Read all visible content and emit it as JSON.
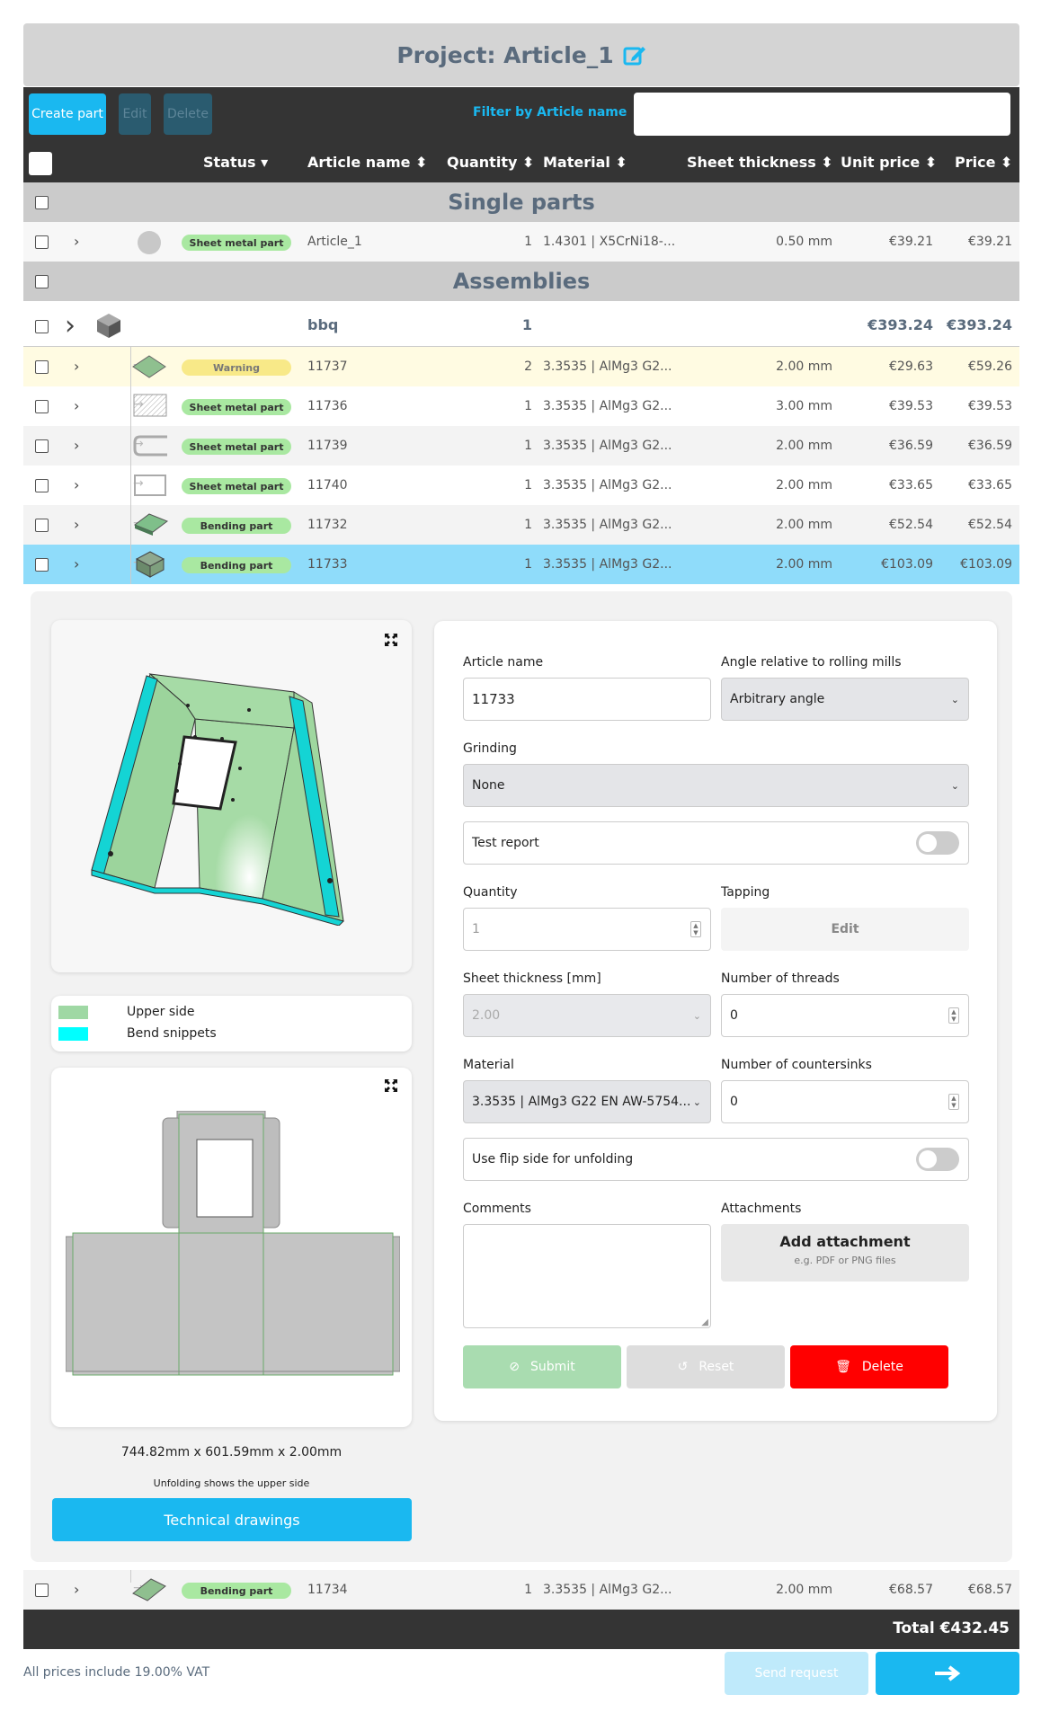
{
  "project": {
    "title": "Project: Article_1"
  },
  "toolbar": {
    "create_label": "Create part",
    "edit_label": "Edit",
    "delete_label": "Delete",
    "filter_label": "Filter by Article name",
    "filter_value": ""
  },
  "columns": {
    "status": "Status",
    "article": "Article name",
    "quantity": "Quantity",
    "material": "Material",
    "thickness": "Sheet thickness",
    "unit_price": "Unit price",
    "price": "Price"
  },
  "sections": {
    "single": "Single parts",
    "assemblies": "Assemblies"
  },
  "single_parts": [
    {
      "status": "Sheet metal part",
      "name": "Article_1",
      "qty": "1",
      "material": "1.4301 | X5CrNi18-...",
      "thickness": "0.50 mm",
      "unit": "€39.21",
      "price": "€39.21"
    }
  ],
  "assembly": {
    "name": "bbq",
    "qty": "1",
    "unit": "€393.24",
    "price": "€393.24"
  },
  "assembly_parts": [
    {
      "status": "Warning",
      "name": "11737",
      "qty": "2",
      "material": "3.3535 | AlMg3 G2...",
      "thickness": "2.00 mm",
      "unit": "€29.63",
      "price": "€59.26"
    },
    {
      "status": "Sheet metal part",
      "name": "11736",
      "qty": "1",
      "material": "3.3535 | AlMg3 G2...",
      "thickness": "3.00 mm",
      "unit": "€39.53",
      "price": "€39.53"
    },
    {
      "status": "Sheet metal part",
      "name": "11739",
      "qty": "1",
      "material": "3.3535 | AlMg3 G2...",
      "thickness": "2.00 mm",
      "unit": "€36.59",
      "price": "€36.59"
    },
    {
      "status": "Sheet metal part",
      "name": "11740",
      "qty": "1",
      "material": "3.3535 | AlMg3 G2...",
      "thickness": "2.00 mm",
      "unit": "€33.65",
      "price": "€33.65"
    },
    {
      "status": "Bending part",
      "name": "11732",
      "qty": "1",
      "material": "3.3535 | AlMg3 G2...",
      "thickness": "2.00 mm",
      "unit": "€52.54",
      "price": "€52.54"
    },
    {
      "status": "Bending part",
      "name": "11733",
      "qty": "1",
      "material": "3.3535 | AlMg3 G2...",
      "thickness": "2.00 mm",
      "unit": "€103.09",
      "price": "€103.09"
    }
  ],
  "last_part": {
    "status": "Bending part",
    "name": "11734",
    "qty": "1",
    "material": "3.3535 | AlMg3 G2...",
    "thickness": "2.00 mm",
    "unit": "€68.57",
    "price": "€68.57"
  },
  "legend": {
    "upper": "Upper side",
    "bend": "Bend snippets",
    "upper_color": "#9fd8a4",
    "bend_color": "#00ffff"
  },
  "viewer": {
    "dimensions": "744.82mm x 601.59mm x 2.00mm",
    "unfold_note": "Unfolding shows the upper side",
    "tech_label": "Technical drawings"
  },
  "form": {
    "article_label": "Article name",
    "article_value": "11733",
    "angle_label": "Angle relative to rolling mills",
    "angle_value": "Arbitrary angle",
    "grinding_label": "Grinding",
    "grinding_value": "None",
    "test_report_label": "Test report",
    "quantity_label": "Quantity",
    "quantity_value": "1",
    "tapping_label": "Tapping",
    "tapping_button": "Edit",
    "thickness_label": "Sheet thickness [mm]",
    "thickness_value": "2.00",
    "threads_label": "Number of threads",
    "threads_value": "0",
    "material_label": "Material",
    "material_value": "3.3535 | AlMg3 G22 EN AW-5754...",
    "countersinks_label": "Number of countersinks",
    "countersinks_value": "0",
    "flip_label": "Use flip side for unfolding",
    "comments_label": "Comments",
    "attachments_label": "Attachments",
    "add_attachment": "Add attachment",
    "attachment_hint": "e.g. PDF or PNG files",
    "submit": "Submit",
    "reset": "Reset",
    "delete": "Delete"
  },
  "footer": {
    "total": "Total €432.45",
    "vat_note": "All prices include 19.00% VAT",
    "send_request": "Send request"
  },
  "colors": {
    "accent": "#1ab8f0",
    "selected_row": "#8fdcfa",
    "warning_row": "#fffbe2",
    "delete": "#ff0000",
    "submit_disabled": "#a9dcb0"
  }
}
